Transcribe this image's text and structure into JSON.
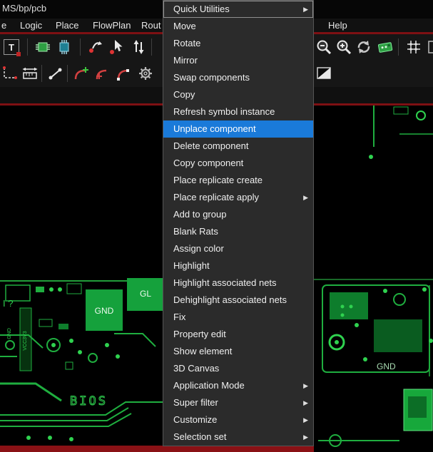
{
  "title_bar": {
    "title": "MS/bp/pcb"
  },
  "menu_bar": {
    "items": [
      {
        "label": "e"
      },
      {
        "label": "Logic"
      },
      {
        "label": "Place"
      },
      {
        "label": "FlowPlan"
      },
      {
        "label": "Rout"
      },
      {
        "label": "Help"
      }
    ]
  },
  "toolbar": {
    "text_tool_glyph": "T",
    "row1_icons": [
      "text-tool",
      "component-place-green",
      "component-place-teal",
      "slide",
      "move-cursor",
      "spin-arrows",
      "zoom-out",
      "zoom-in",
      "redraw",
      "board-view",
      "grid-toggle"
    ],
    "row2_icons": [
      "dimension",
      "ruler",
      "segment",
      "fillet-add",
      "fillet-edit",
      "fillet-nodes",
      "settings-gear",
      "shade-mode"
    ]
  },
  "context_menu": {
    "submenu_arrow": "▶",
    "selected_label": "Unplace component",
    "items": [
      {
        "label": "Quick Utilities",
        "submenu": true
      },
      {
        "label": "Move",
        "submenu": false
      },
      {
        "label": "Rotate",
        "submenu": false
      },
      {
        "label": "Mirror",
        "submenu": false
      },
      {
        "label": "Swap components",
        "submenu": false
      },
      {
        "label": "Copy",
        "submenu": false
      },
      {
        "label": "Refresh symbol instance",
        "submenu": false
      },
      {
        "label": "Unplace component",
        "submenu": false,
        "selected": true
      },
      {
        "label": "Delete component",
        "submenu": false
      },
      {
        "label": "Copy component",
        "submenu": false
      },
      {
        "label": "Place replicate create",
        "submenu": false
      },
      {
        "label": "Place replicate apply",
        "submenu": true
      },
      {
        "label": "Add to group",
        "submenu": false
      },
      {
        "label": "Blank Rats",
        "submenu": false
      },
      {
        "label": "Assign color",
        "submenu": false
      },
      {
        "label": "Highlight",
        "submenu": false
      },
      {
        "label": "Highlight associated nets",
        "submenu": false
      },
      {
        "label": "Dehighlight associated nets",
        "submenu": false
      },
      {
        "label": "Fix",
        "submenu": false
      },
      {
        "label": "Property edit",
        "submenu": false
      },
      {
        "label": "Show element",
        "submenu": false
      },
      {
        "label": "3D Canvas",
        "submenu": false
      },
      {
        "label": "Application Mode",
        "submenu": true
      },
      {
        "label": "Super filter",
        "submenu": true
      },
      {
        "label": "Customize",
        "submenu": true
      },
      {
        "label": "Selection set",
        "submenu": true
      }
    ]
  },
  "canvas": {
    "labels": {
      "gnd_left": "GND",
      "gl_partial": "GL",
      "marking": "I ?",
      "vcc_vertical": "VCC3V3",
      "gnd_small_left": "GND",
      "gnd_right": "GND",
      "bios": "BIOS"
    }
  },
  "colors": {
    "selection_blue": "#1a7ad9",
    "chrome_red": "#7e1013",
    "pcb_green_bright": "#2fd24f",
    "pcb_green_fill": "#15a13c",
    "menu_bg": "#2b2b2b"
  }
}
